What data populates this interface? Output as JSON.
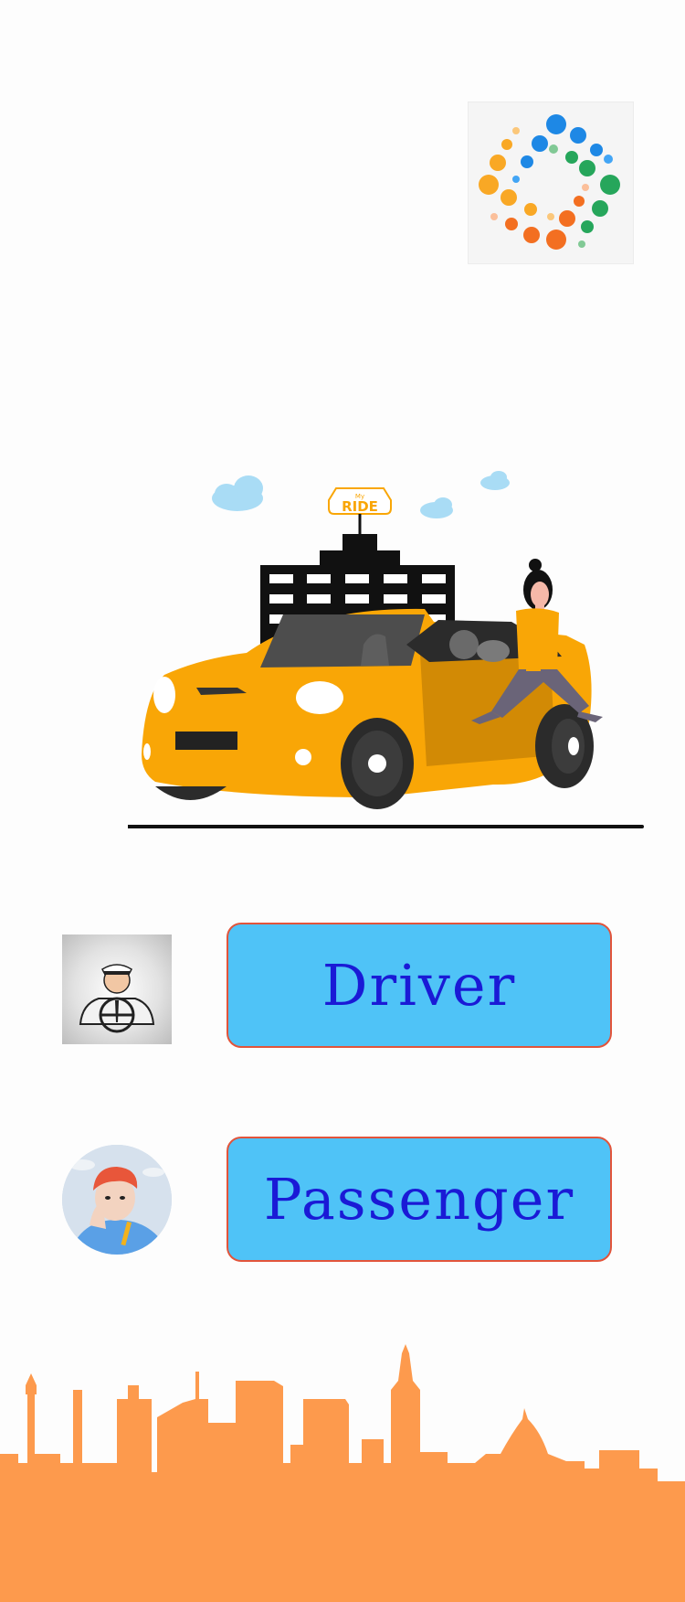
{
  "app": {
    "logo_icon": "dots-circle-logo-icon",
    "illustration": "taxi-car-with-passenger-illustration",
    "sign_small": "My",
    "sign_big": "RIDE"
  },
  "roles": {
    "driver_label": "Driver",
    "driver_avatar_icon": "chauffeur-avatar-icon",
    "passenger_label": "Passenger",
    "passenger_avatar_icon": "passenger-avatar-icon"
  },
  "footer": {
    "skyline_icon": "city-skyline-graphic"
  },
  "colors": {
    "button_fill": "#4fc3f7",
    "button_border": "#e2543b",
    "button_text": "#1a1ad6",
    "skyline": "#fd9a4d",
    "car": "#f9a606"
  }
}
